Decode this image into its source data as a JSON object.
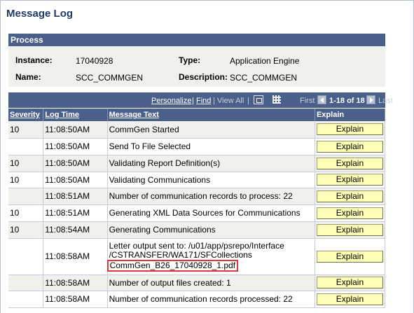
{
  "page": {
    "title": "Message Log"
  },
  "process": {
    "header": "Process",
    "instance_label": "Instance:",
    "instance_value": "17040928",
    "type_label": "Type:",
    "type_value": "Application Engine",
    "name_label": "Name:",
    "name_value": "SCC_COMMGEN",
    "description_label": "Description:",
    "description_value": "SCC_COMMGEN"
  },
  "grid_nav": {
    "personalize": "Personalize",
    "sep1": "|",
    "find": "Find",
    "sep2": "|",
    "view_all": "View All",
    "sep3": "|",
    "first": "First",
    "range": "1-18 of 18",
    "last": "Last",
    "icons": [
      "download-icon",
      "grid-icon",
      "prev-icon",
      "next-icon"
    ]
  },
  "columns": {
    "severity": "Severity",
    "log_time": "Log Time",
    "message_text": "Message Text",
    "explain": "Explain"
  },
  "explain_label": "Explain",
  "rows": [
    {
      "severity": "10",
      "time": "11:08:50AM",
      "msg": "CommGen Started"
    },
    {
      "severity": "",
      "time": "11:08:50AM",
      "msg": "Send To File Selected"
    },
    {
      "severity": "10",
      "time": "11:08:50AM",
      "msg": "Validating Report Definition(s)"
    },
    {
      "severity": "10",
      "time": "11:08:50AM",
      "msg": "Validating Communications"
    },
    {
      "severity": "",
      "time": "11:08:51AM",
      "msg": "Number of communication records to process: 22"
    },
    {
      "severity": "10",
      "time": "11:08:51AM",
      "msg": "Generating XML Data Sources for Communications"
    },
    {
      "severity": "10",
      "time": "11:08:54AM",
      "msg": "Generating Communications"
    },
    {
      "severity": "",
      "time": "11:08:58AM",
      "msg_line1": "Letter output sent to: /u01/app/psrepo/Interface",
      "msg_line2": "/CSTRANSFER/WA171/SFCollections",
      "msg_line3": "CommGen_B26_17040928_1.pdf"
    },
    {
      "severity": "",
      "time": "11:08:58AM",
      "msg": "Number of output files created: 1"
    },
    {
      "severity": "",
      "time": "11:08:58AM",
      "msg": "Number of communication records processed: 22"
    }
  ],
  "colors": {
    "header_bg": "#4a5f8a",
    "row_alt": "#f0f1ec",
    "button_bg": "#ffffb8",
    "highlight": "#e0363a",
    "title": "#1f3a67"
  }
}
